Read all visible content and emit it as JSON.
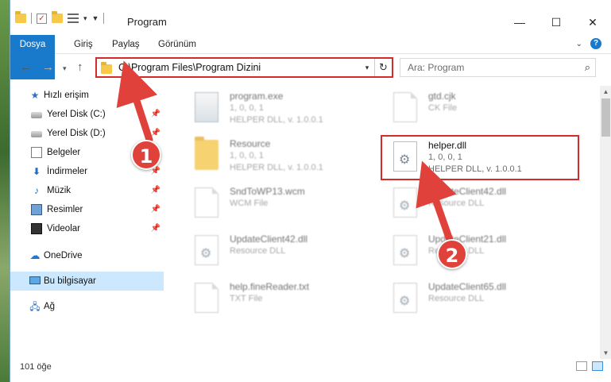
{
  "window": {
    "title": "Program",
    "controls": {
      "minimize": "—",
      "maximize": "☐",
      "close": "✕"
    }
  },
  "ribbon": {
    "tabs": [
      "Dosya",
      "Giriş",
      "Paylaş",
      "Görünüm"
    ],
    "collapse_icon": "chevron-down-icon",
    "help_label": "?"
  },
  "address": {
    "path": "C:\\Program Files\\Program Dizini",
    "search_placeholder": "Ara: Program"
  },
  "sidebar": {
    "quick_access": "Hızlı erişim",
    "items": [
      {
        "label": "Yerel Disk (C:)",
        "icon": "drive-icon",
        "pinned": true
      },
      {
        "label": "Yerel Disk (D:)",
        "icon": "drive-icon",
        "pinned": true
      },
      {
        "label": "Belgeler",
        "icon": "documents-icon",
        "pinned": true
      },
      {
        "label": "İndirmeler",
        "icon": "downloads-icon",
        "pinned": true
      },
      {
        "label": "Müzik",
        "icon": "music-icon",
        "pinned": true
      },
      {
        "label": "Resimler",
        "icon": "pictures-icon",
        "pinned": true
      },
      {
        "label": "Videolar",
        "icon": "videos-icon",
        "pinned": true
      }
    ],
    "onedrive": "OneDrive",
    "this_pc": "Bu bilgisayar",
    "network": "Ağ"
  },
  "files": {
    "left": [
      {
        "name": "program.exe",
        "line2": "1, 0, 0, 1",
        "line3": "HELPER DLL, v. 1.0.0.1",
        "icon": "exe-icon"
      },
      {
        "name": "Resource",
        "line2": "1, 0, 0, 1",
        "line3": "HELPER DLL, v. 1.0.0.1",
        "icon": "folder-icon"
      },
      {
        "name": "SndToWP13.wcm",
        "line2": "WCM File",
        "line3": "",
        "icon": "file-icon"
      },
      {
        "name": "UpdateClient42.dll",
        "line2": "Resource DLL",
        "line3": "",
        "icon": "dll-icon"
      },
      {
        "name": "help.fineReader.txt",
        "line2": "TXT File",
        "line3": "",
        "icon": "file-icon"
      }
    ],
    "right": [
      {
        "name": "gtd.cjk",
        "line2": "CK File",
        "line3": "",
        "icon": "file-icon"
      },
      {
        "name": "helper.dll",
        "line2": "1, 0, 0, 1",
        "line3": "HELPER DLL, v. 1.0.0.1",
        "icon": "dll-icon"
      },
      {
        "name": "UpdateClient42.dll",
        "line2": "Resource DLL",
        "line3": "",
        "icon": "dll-icon"
      },
      {
        "name": "UpdateClient21.dll",
        "line2": "Resource DLL",
        "line3": "",
        "icon": "dll-icon"
      },
      {
        "name": "UpdateClient65.dll",
        "line2": "Resource DLL",
        "line3": "",
        "icon": "dll-icon"
      }
    ]
  },
  "status": {
    "count": "101 öğe"
  },
  "callouts": [
    "1",
    "2"
  ],
  "colors": {
    "accent": "#1979ca",
    "highlight": "#d42b2b",
    "selected": "#cce8ff"
  }
}
